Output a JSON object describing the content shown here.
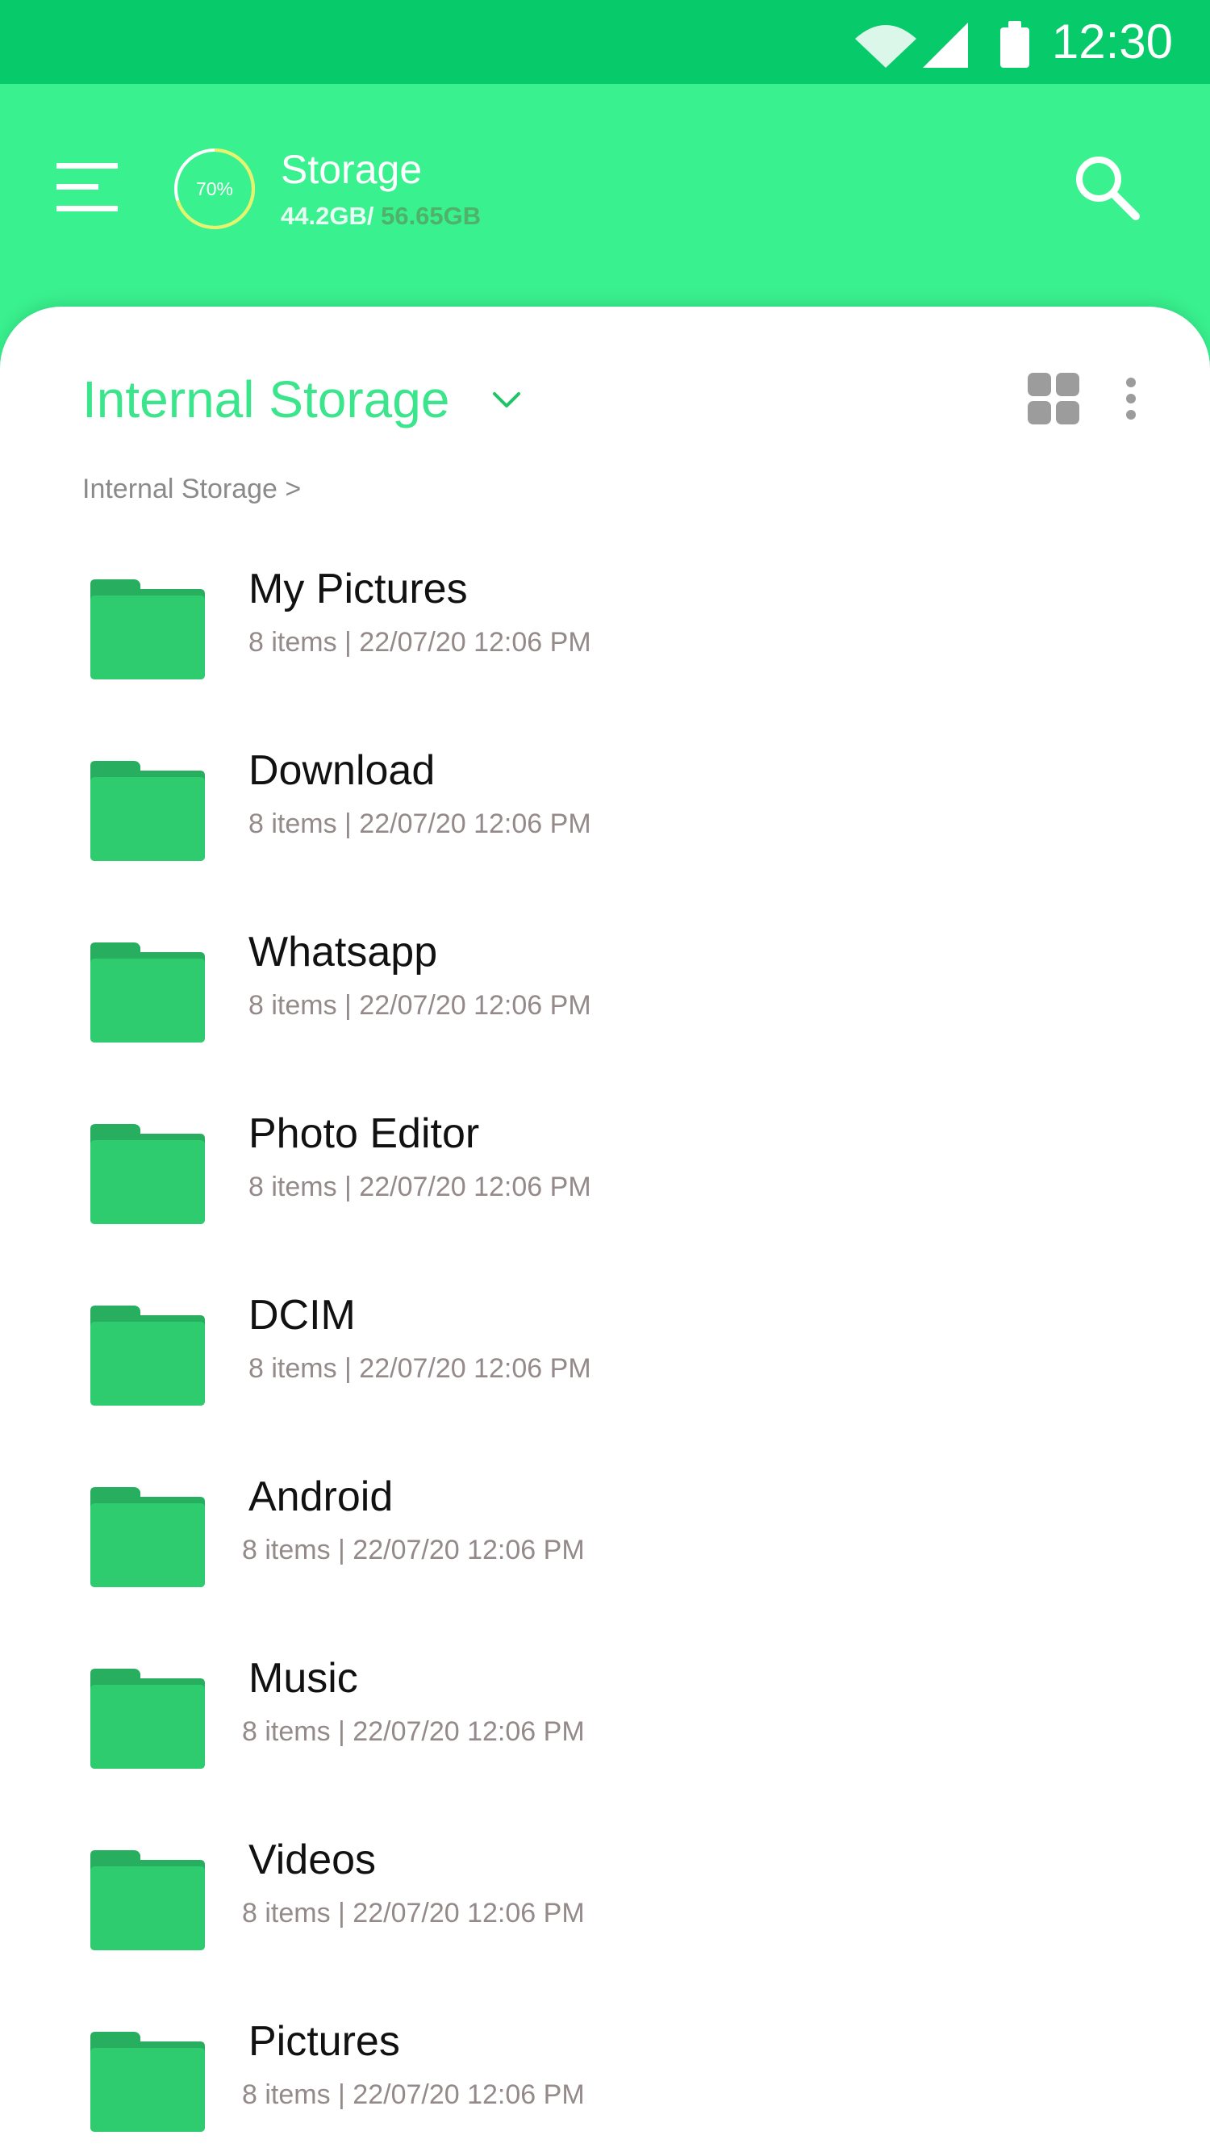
{
  "status_bar": {
    "time": "12:30",
    "icons": [
      "wifi-icon",
      "cellular-signal-icon",
      "battery-icon"
    ]
  },
  "header": {
    "storage_title": "Storage",
    "used": "44.2GB",
    "separator": "/",
    "total": " 56.65GB",
    "percent_label": "70%",
    "percent_value": 0.7
  },
  "location": {
    "title": "Internal Storage",
    "breadcrumb": "Internal Storage >"
  },
  "files": [
    {
      "name": "My Pictures",
      "meta": "8 items | 22/07/20  12:06 PM"
    },
    {
      "name": "Download",
      "meta": "8 items | 22/07/20  12:06 PM"
    },
    {
      "name": "Whatsapp",
      "meta": "8 items | 22/07/20  12:06 PM"
    },
    {
      "name": "Photo Editor",
      "meta": "8 items | 22/07/20  12:06 PM"
    },
    {
      "name": "DCIM",
      "meta": "8 items | 22/07/20  12:06 PM"
    },
    {
      "name": "Android",
      "meta": "8 items | 22/07/20  12:06 PM"
    },
    {
      "name": "Music",
      "meta": "8 items | 22/07/20  12:06 PM"
    },
    {
      "name": "Videos",
      "meta": "8 items | 22/07/20  12:06 PM"
    },
    {
      "name": "Pictures",
      "meta": "8 items | 22/07/20  12:06 PM"
    }
  ],
  "colors": {
    "status_bar": "#07cb6a",
    "header": "#3af18f",
    "accent": "#3ae58c",
    "folder": "#2ecc6e",
    "folder_tab": "#27ae5f",
    "ring": "#e8f36b"
  }
}
